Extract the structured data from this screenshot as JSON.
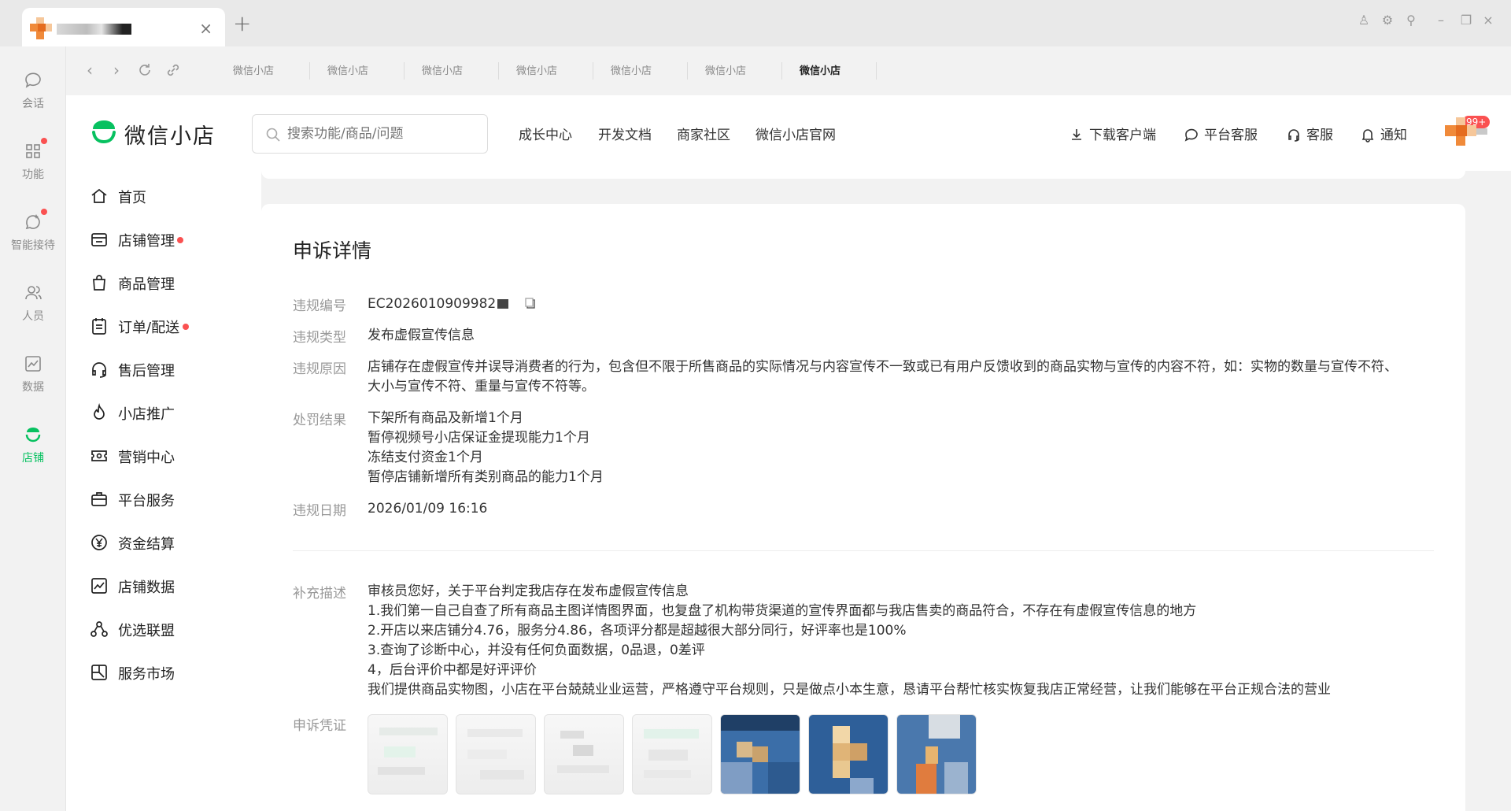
{
  "window": {
    "tab_close": "×",
    "new_tab": "+",
    "controls": [
      "♙",
      "⚙",
      "⚲",
      "–",
      "❐",
      "×"
    ]
  },
  "rail": {
    "items": [
      {
        "label": "会话",
        "icon": "chat-icon"
      },
      {
        "label": "功能",
        "icon": "grid-icon"
      },
      {
        "label": "智能接待",
        "icon": "ai-reception-icon"
      },
      {
        "label": "人员",
        "icon": "people-icon"
      },
      {
        "label": "数据",
        "icon": "chart-icon"
      },
      {
        "label": "店铺",
        "icon": "shop-icon"
      }
    ]
  },
  "browser": {
    "tabs": [
      "微信小店",
      "微信小店",
      "微信小店",
      "微信小店",
      "微信小店",
      "微信小店",
      "微信小店"
    ]
  },
  "header": {
    "brand": "微信小店",
    "search_placeholder": "搜索功能/商品/问题",
    "nav": [
      "成长中心",
      "开发文档",
      "商家社区",
      "微信小店官网"
    ],
    "right": {
      "download": "下载客户端",
      "platform_service": "平台客服",
      "service": "客服",
      "notify": "通知",
      "notify_badge": "99+"
    }
  },
  "sidebar": {
    "items": [
      {
        "label": "首页",
        "icon": "home-icon"
      },
      {
        "label": "店铺管理",
        "icon": "store-icon"
      },
      {
        "label": "商品管理",
        "icon": "bag-icon"
      },
      {
        "label": "订单/配送",
        "icon": "clipboard-icon"
      },
      {
        "label": "售后管理",
        "icon": "headset-icon"
      },
      {
        "label": "小店推广",
        "icon": "flame-icon"
      },
      {
        "label": "营销中心",
        "icon": "coupon-icon"
      },
      {
        "label": "平台服务",
        "icon": "briefcase-icon"
      },
      {
        "label": "资金结算",
        "icon": "yuan-icon"
      },
      {
        "label": "店铺数据",
        "icon": "data-icon"
      },
      {
        "label": "优选联盟",
        "icon": "network-icon"
      },
      {
        "label": "服务市场",
        "icon": "market-icon"
      }
    ]
  },
  "appeal": {
    "title": "申诉详情",
    "fields": {
      "id_label": "违规编号",
      "id_value": "EC2026010909982",
      "type_label": "违规类型",
      "type_value": "发布虚假宣传信息",
      "reason_label": "违规原因",
      "reason_lines": [
        "店铺存在虚假宣传并误导消费者的行为，包含但不限于所售商品的实际情况与内容宣传不一致或已有用户反馈收到的商品实物与宣传的内容不符，如：实物的数量与宣传不符、",
        "大小与宣传不符、重量与宣传不符等。"
      ],
      "penalty_label": "处罚结果",
      "penalty_lines": [
        "下架所有商品及新增1个月",
        "暂停视频号小店保证金提现能力1个月",
        "冻结支付资金1个月",
        "暂停店铺新增所有类别商品的能力1个月"
      ],
      "date_label": "违规日期",
      "date_value": "2026/01/09 16:16",
      "supplement_label": "补充描述",
      "supplement_lines": [
        "审核员您好，关于平台判定我店存在发布虚假宣传信息",
        "1.我们第一自己自查了所有商品主图详情图界面，也复盘了机构带货渠道的宣传界面都与我店售卖的商品符合，不存在有虚假宣传信息的地方",
        "2.开店以来店铺分4.76，服务分4.86，各项评分都是超越很大部分同行，好评率也是100%",
        "3.查询了诊断中心，并没有任何负面数据，0品退，0差评",
        "4，后台评价中都是好评评价",
        "我们提供商品实物图，小店在平台兢兢业业运营，严格遵守平台规则，只是做点小本生意，恳请平台帮忙核实恢复我店正常经营，让我们能够在平台正规合法的营业"
      ],
      "evidence_label": "申诉凭证"
    }
  },
  "colors": {
    "accent": "#07c160",
    "badge": "#fa5151",
    "label_gray": "#999999"
  }
}
